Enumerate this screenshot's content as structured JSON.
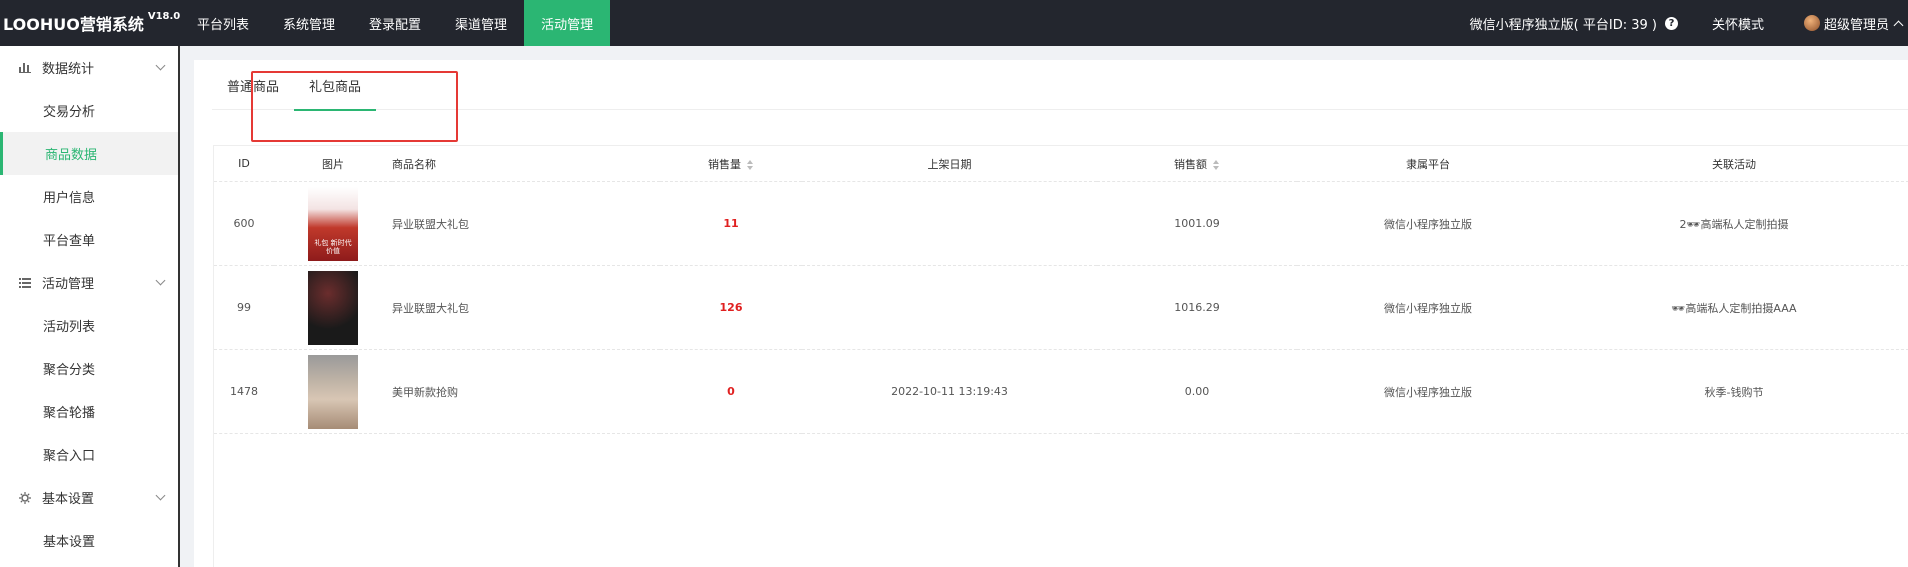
{
  "header": {
    "brand": "LOOHUO营销系统",
    "version": "V18.0",
    "nav": [
      {
        "label": "平台列表",
        "active": false
      },
      {
        "label": "系统管理",
        "active": false
      },
      {
        "label": "登录配置",
        "active": false
      },
      {
        "label": "渠道管理",
        "active": false
      },
      {
        "label": "活动管理",
        "active": true
      }
    ],
    "platform_info": "微信小程序独立版( 平台ID: 39 )",
    "care_mode": "关怀模式",
    "admin_name": "超级管理员",
    "active_color": "#2bb673"
  },
  "sidebar": {
    "groups": [
      {
        "label": "数据统计",
        "icon": "bar-chart-icon",
        "items": [
          "交易分析",
          "商品数据",
          "用户信息",
          "平台查单"
        ]
      },
      {
        "label": "活动管理",
        "icon": "list-icon",
        "items": [
          "活动列表",
          "聚合分类",
          "聚合轮播",
          "聚合入口"
        ]
      },
      {
        "label": "基本设置",
        "icon": "settings-icon",
        "items": [
          "基本设置"
        ]
      }
    ],
    "active_item": "商品数据"
  },
  "tabs": [
    {
      "label": "普通商品",
      "active": false
    },
    {
      "label": "礼包商品",
      "active": true
    }
  ],
  "table": {
    "columns": [
      "ID",
      "图片",
      "商品名称",
      "销售量",
      "上架日期",
      "销售额",
      "隶属平台",
      "关联活动"
    ],
    "rows": [
      {
        "id": "600",
        "image": "gift-poster-red",
        "image_text": "礼包 新时代 价值",
        "name": "异业联盟大礼包",
        "sales": "11",
        "date": "",
        "amount": "1001.09",
        "platform": "微信小程序独立版",
        "activity": "2🕶高端私人定制拍摄"
      },
      {
        "id": "99",
        "image": "rose-bouquet",
        "name": "异业联盟大礼包",
        "sales": "126",
        "date": "",
        "amount": "1016.29",
        "platform": "微信小程序独立版",
        "activity": "🕶高端私人定制拍摄AAA"
      },
      {
        "id": "1478",
        "image": "manicure-nails",
        "name": "美甲新款抢购",
        "sales": "0",
        "date": "2022-10-11 13:19:43",
        "amount": "0.00",
        "platform": "微信小程序独立版",
        "activity": "秋季-钱购节"
      }
    ]
  }
}
